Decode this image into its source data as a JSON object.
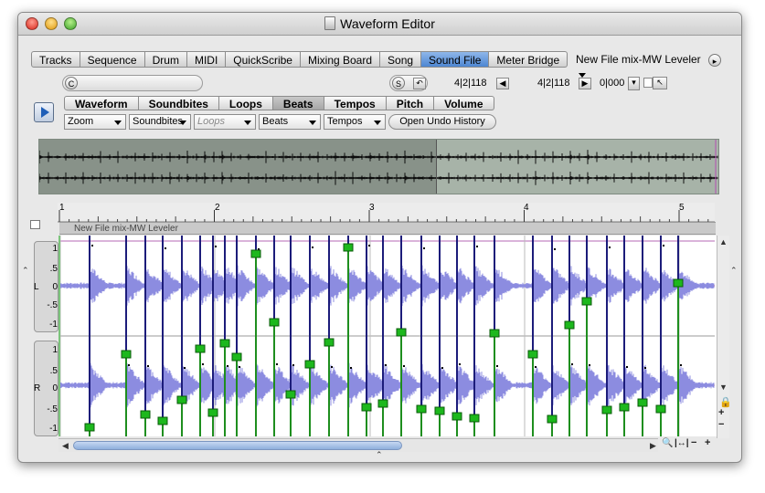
{
  "window": {
    "title": "Waveform Editor"
  },
  "tabs": [
    "Tracks",
    "Sequence",
    "Drum",
    "MIDI",
    "QuickScribe",
    "Mixing Board",
    "Song",
    "Sound File",
    "Meter Bridge"
  ],
  "active_tab": "Sound File",
  "file_selector": "New File mix-MW Leveler",
  "toolbar": {
    "c_button": "C",
    "s_button": "S",
    "position_start": "4|2|118",
    "position_end": "4|2|118",
    "position_extra": "0|000"
  },
  "subtabs": [
    "Waveform",
    "Soundbites",
    "Loops",
    "Beats",
    "Tempos",
    "Pitch",
    "Volume"
  ],
  "active_subtab": "Beats",
  "dropdowns": {
    "zoom": "Zoom",
    "soundbites": "Soundbites",
    "loops": "Loops",
    "beats": "Beats",
    "tempos": "Tempos"
  },
  "undo_button": "Open Undo History",
  "track_name": "New File mix-MW Leveler",
  "ruler": {
    "bars": [
      "1",
      "2",
      "3",
      "4",
      "5"
    ]
  },
  "lanes": {
    "left": {
      "label": "L",
      "ticks": [
        "1",
        ".5",
        "0",
        "-.5",
        "-1"
      ]
    },
    "right": {
      "label": "R",
      "ticks": [
        "1",
        ".5",
        "0",
        "-.5",
        "-1"
      ]
    }
  },
  "controls": {
    "plus": "+",
    "minus": "−"
  },
  "colors": {
    "waveform": "#8c8ce0",
    "beat_marker": "#1c1c7a",
    "beat_handle": "#1db81d",
    "active_tab": "#5a8fd6"
  }
}
